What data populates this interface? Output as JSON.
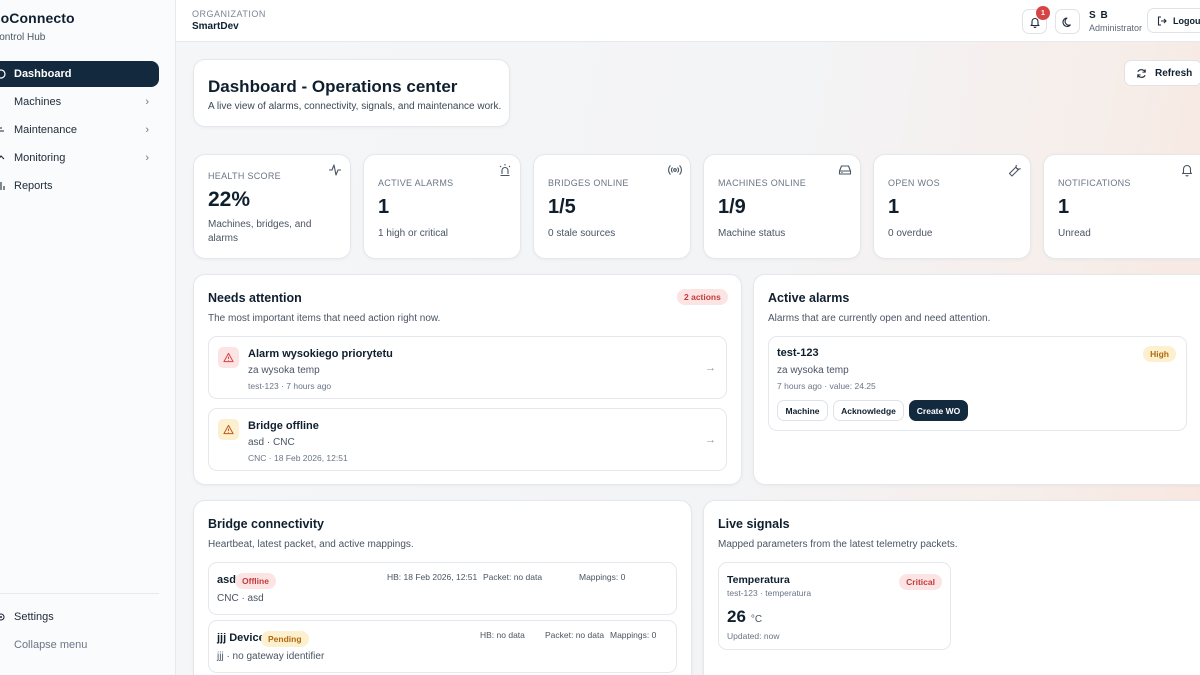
{
  "sidebar": {
    "brand": "goConnecto",
    "subtitle": "Control Hub",
    "items": [
      {
        "label": "Dashboard"
      },
      {
        "label": "Machines"
      },
      {
        "label": "Maintenance"
      },
      {
        "label": "Monitoring"
      },
      {
        "label": "Reports"
      }
    ],
    "settings": "Settings",
    "collapse": "Collapse menu"
  },
  "topbar": {
    "org_label": "ORGANIZATION",
    "org_name": "SmartDev",
    "notification_count": "1",
    "user_initials": "S B",
    "user_role": "Administrator",
    "logout": "Logout"
  },
  "hero": {
    "title": "Dashboard - Operations center",
    "subtitle": "A live view of alarms, connectivity, signals, and maintenance work.",
    "refresh": "Refresh"
  },
  "stats": [
    {
      "label": "HEALTH SCORE",
      "value": "22%",
      "desc": "Machines, bridges, and alarms",
      "icon": "activity-icon"
    },
    {
      "label": "ACTIVE ALARMS",
      "value": "1",
      "desc": "1 high or critical",
      "icon": "siren-icon"
    },
    {
      "label": "BRIDGES ONLINE",
      "value": "1/5",
      "desc": "0 stale sources",
      "icon": "radio-icon"
    },
    {
      "label": "MACHINES ONLINE",
      "value": "1/9",
      "desc": "Machine status",
      "icon": "hard-drive-icon"
    },
    {
      "label": "OPEN WOS",
      "value": "1",
      "desc": "0 overdue",
      "icon": "wrench-icon"
    },
    {
      "label": "NOTIFICATIONS",
      "value": "1",
      "desc": "Unread",
      "icon": "bell-icon"
    }
  ],
  "needs_attention": {
    "title": "Needs attention",
    "subtitle": "The most important items that need action right now.",
    "badge": "2 actions",
    "items": [
      {
        "title": "Alarm wysokiego priorytetu",
        "sub": "za wysoka temp",
        "meta": "test-123 · 7 hours ago",
        "severity": "#d64545"
      },
      {
        "title": "Bridge offline",
        "sub": "asd · CNC",
        "meta": "CNC · 18 Feb 2026, 12:51",
        "severity": "#d9a21b"
      }
    ]
  },
  "active_alarms": {
    "title": "Active alarms",
    "subtitle": "Alarms that are currently open and need attention.",
    "alarm": {
      "name": "test-123",
      "severity": "High",
      "desc": "za wysoka temp",
      "meta": "7 hours ago · value: 24.25",
      "buttons": {
        "machine": "Machine",
        "acknowledge": "Acknowledge",
        "create_wo": "Create WO"
      }
    }
  },
  "bridge_connectivity": {
    "title": "Bridge connectivity",
    "subtitle": "Heartbeat, latest packet, and active mappings.",
    "bridges": [
      {
        "name": "asd",
        "status": "Offline",
        "sub": "CNC · asd",
        "hb": "HB: 18 Feb 2026, 12:51",
        "packet": "Packet: no data",
        "mappings": "Mappings: 0"
      },
      {
        "name": "jjj Device",
        "status": "Pending",
        "sub": "jjj · no gateway identifier",
        "hb": "HB: no data",
        "packet": "Packet: no data",
        "mappings": "Mappings: 0"
      }
    ]
  },
  "live_signals": {
    "title": "Live signals",
    "subtitle": "Mapped parameters from the latest telemetry packets.",
    "signal": {
      "name": "Temperatura",
      "source": "test-123 · temperatura",
      "status": "Critical",
      "value": "26",
      "unit": "°C",
      "updated": "Updated: now"
    }
  },
  "colors": {
    "accent_dark": "#13293d",
    "danger": "#d64545",
    "warning": "#d9a21b"
  }
}
